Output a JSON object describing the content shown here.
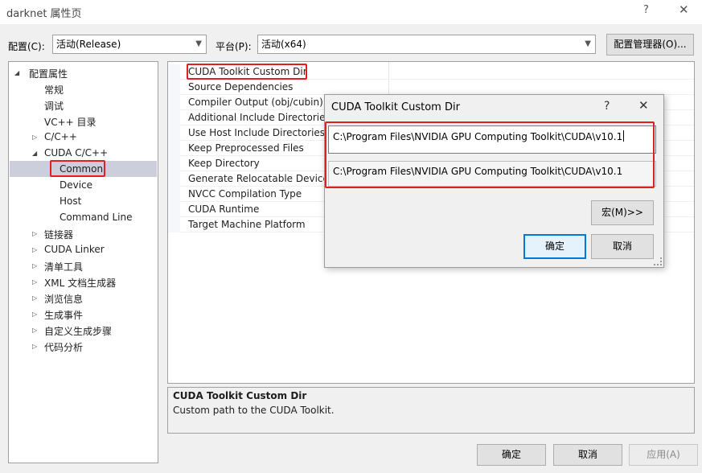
{
  "window": {
    "title": "darknet 属性页",
    "help_glyph": "?",
    "close_glyph": "✕"
  },
  "config_row": {
    "config_label": "配置(C):",
    "config_value": "活动(Release)",
    "platform_label": "平台(P):",
    "platform_value": "活动(x64)",
    "manager_button": "配置管理器(O)..."
  },
  "tree": {
    "items": [
      {
        "label": "配置属性",
        "expander": "◢"
      },
      {
        "label": "常规",
        "expander": ""
      },
      {
        "label": "调试",
        "expander": ""
      },
      {
        "label": "VC++ 目录",
        "expander": ""
      },
      {
        "label": "C/C++",
        "expander": "▷"
      },
      {
        "label": "CUDA C/C++",
        "expander": "◢"
      },
      {
        "label": "Common",
        "expander": ""
      },
      {
        "label": "Device",
        "expander": ""
      },
      {
        "label": "Host",
        "expander": ""
      },
      {
        "label": "Command Line",
        "expander": ""
      },
      {
        "label": "链接器",
        "expander": "▷"
      },
      {
        "label": "CUDA Linker",
        "expander": "▷"
      },
      {
        "label": "清单工具",
        "expander": "▷"
      },
      {
        "label": "XML 文档生成器",
        "expander": "▷"
      },
      {
        "label": "浏览信息",
        "expander": "▷"
      },
      {
        "label": "生成事件",
        "expander": "▷"
      },
      {
        "label": "自定义生成步骤",
        "expander": "▷"
      },
      {
        "label": "代码分析",
        "expander": "▷"
      }
    ]
  },
  "properties": [
    "CUDA Toolkit Custom Dir",
    "Source Dependencies",
    "Compiler Output (obj/cubin)",
    "Additional Include Directories",
    "Use Host Include Directories",
    "Keep Preprocessed Files",
    "Keep Directory",
    "Generate Relocatable Device",
    "NVCC Compilation Type",
    "CUDA Runtime",
    "Target Machine Platform"
  ],
  "description": {
    "title": "CUDA Toolkit Custom Dir",
    "text": "Custom path to the CUDA Toolkit."
  },
  "dialog": {
    "title": "CUDA Toolkit Custom Dir",
    "help_glyph": "?",
    "close_glyph": "✕",
    "input_value": "C:\\Program Files\\NVIDIA GPU Computing Toolkit\\CUDA\\v10.1",
    "evaluated_value": "C:\\Program Files\\NVIDIA GPU Computing Toolkit\\CUDA\\v10.1",
    "macro_button": "宏(M)>>",
    "ok_button": "确定",
    "cancel_button": "取消"
  },
  "footer": {
    "ok_button": "确定",
    "cancel_button": "取消",
    "apply_button": "应用(A)"
  },
  "colors": {
    "highlight_red": "#e02020",
    "selection": "#cccedb",
    "ok_border": "#0078d7"
  }
}
